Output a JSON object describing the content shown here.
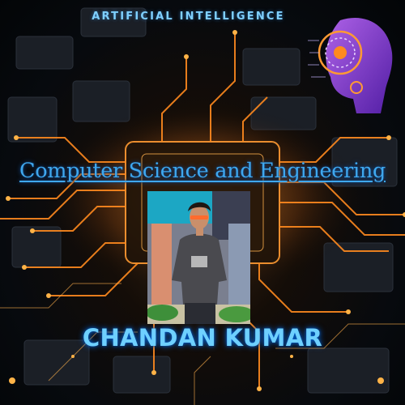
{
  "header": {
    "label": "ARTIFICIAL INTELLIGENCE"
  },
  "title": "Computer Science and Engineering",
  "name": "CHANDAN KUMAR",
  "colors": {
    "accent": "#4fb6ff",
    "glow": "#ff8a1f",
    "robot": "#a855f7"
  },
  "icons": {
    "robot_graphic": "ai-robot-head-icon",
    "photo": "profile-photo"
  }
}
